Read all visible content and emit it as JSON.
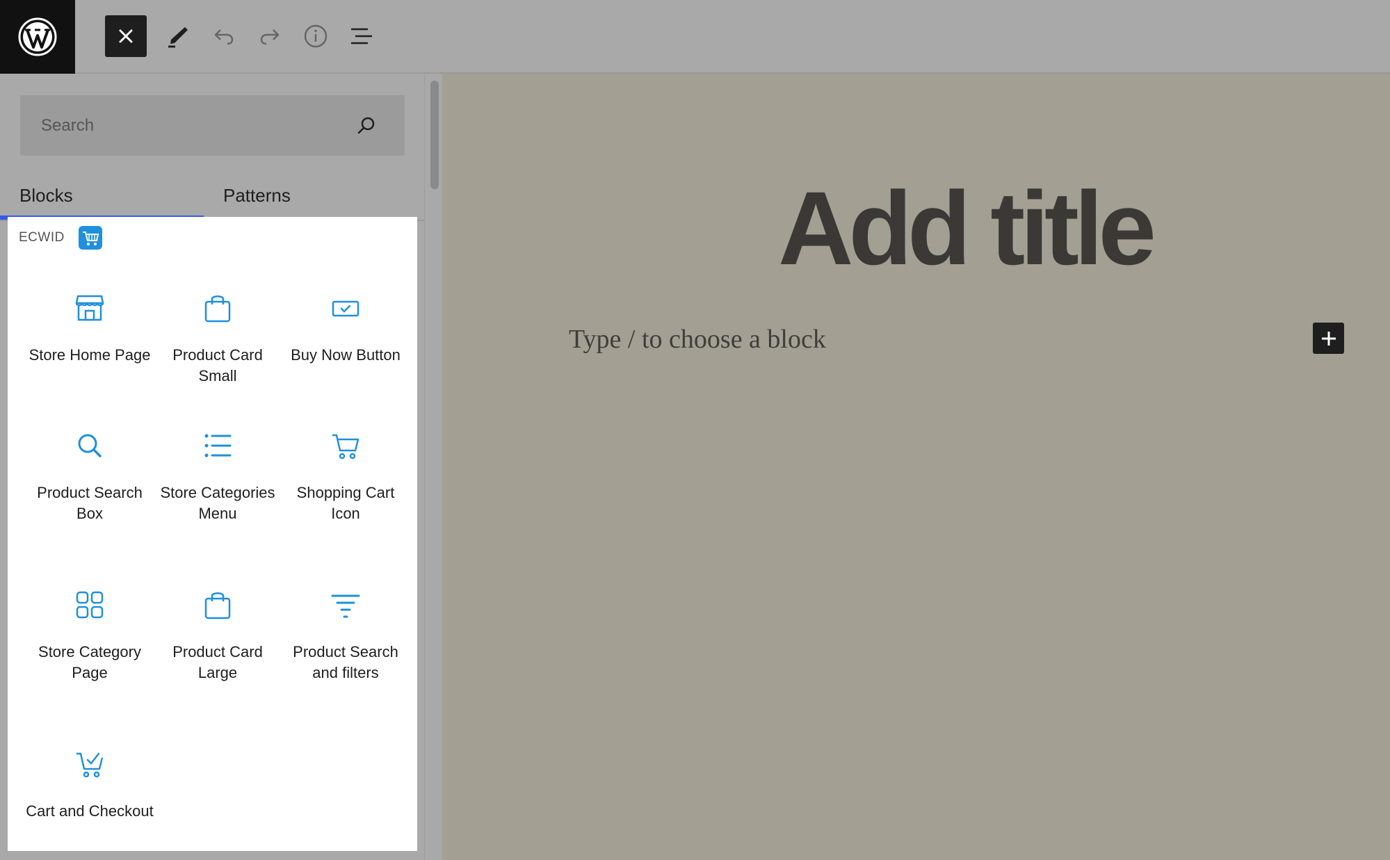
{
  "toolbar": {
    "logo": "wordpress-icon",
    "close": "close-icon",
    "tools": "pencil-icon",
    "undo": "undo-icon",
    "redo": "redo-icon",
    "info": "info-icon",
    "list_view": "list-view-icon"
  },
  "inserter": {
    "search": {
      "placeholder": "Search",
      "value": ""
    },
    "tabs": [
      {
        "label": "Blocks",
        "active": true
      },
      {
        "label": "Patterns",
        "active": false
      }
    ],
    "category": {
      "label": "ECWID",
      "icon": "ecwid-cart-icon"
    },
    "blocks": [
      {
        "label": "Store Home Page",
        "icon": "storefront-icon"
      },
      {
        "label": "Product Card Small",
        "icon": "shopping-bag-icon"
      },
      {
        "label": "Buy Now Button",
        "icon": "buy-button-icon"
      },
      {
        "label": "Product Search Box",
        "icon": "search-icon"
      },
      {
        "label": "Store Categories Menu",
        "icon": "list-icon"
      },
      {
        "label": "Shopping Cart Icon",
        "icon": "cart-icon"
      },
      {
        "label": "Store Category Page",
        "icon": "grid-icon"
      },
      {
        "label": "Product Card Large",
        "icon": "shopping-bag-icon"
      },
      {
        "label": "Product Search and filters",
        "icon": "filter-icon"
      },
      {
        "label": "Cart and Checkout",
        "icon": "cart-check-icon"
      }
    ]
  },
  "editor": {
    "title_placeholder": "Add title",
    "block_placeholder": "Type / to choose a block",
    "add_block": "plus-icon"
  },
  "colors": {
    "accent": "#3858e9",
    "icon_blue": "#1e90dd",
    "canvas": "#a39f93"
  }
}
